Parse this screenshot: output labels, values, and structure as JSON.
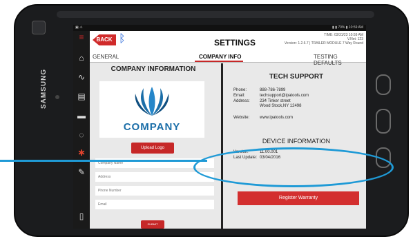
{
  "device": {
    "brand": "SAMSUNG"
  },
  "statusbar": {
    "left": "▣ ⚠",
    "right": "▮ ▮ 70% ▮ 10:59 AM"
  },
  "header": {
    "back_label": "BACK",
    "title": "SETTINGS",
    "time_line": "TIME: 03/31/23 10:59 AM",
    "vnet_line": "V.Net: 123",
    "version_line": "Version: 1.2.6.7 | TRAILER MODULE 7 Way Round"
  },
  "tabs": [
    "GENERAL",
    "COMPANY INFO",
    "TESTING DEFAULTS"
  ],
  "company": {
    "title": "COMPANY INFORMATION",
    "logo_text": "COMPANY",
    "upload_label": "Upload Logo",
    "fields": [
      "Company Name",
      "Address",
      "Phone Number",
      "Email"
    ],
    "submit_label": "SUBMIT"
  },
  "support": {
    "title": "TECH SUPPORT",
    "phone_k": "Phone:",
    "phone_v": "888-786-7899",
    "email_k": "Email:",
    "email_v": "techsupport@ipatools.com",
    "address_k": "Address:",
    "address_v1": "234 Tinker street",
    "address_v2": "Wood Stock,NY 12498",
    "website_k": "Website:",
    "website_v": "www.ipatools.com"
  },
  "device_info": {
    "title": "DEVICE INFORMATION",
    "version_k": "Version:",
    "version_v": "11.00.001",
    "update_k": "Last Update:",
    "update_v": "03/04/2016"
  },
  "warranty_label": "Register Warranty",
  "colors": {
    "accent": "#c62828",
    "highlight": "#1f9ad6",
    "brand_blue": "#1b6ea8"
  }
}
